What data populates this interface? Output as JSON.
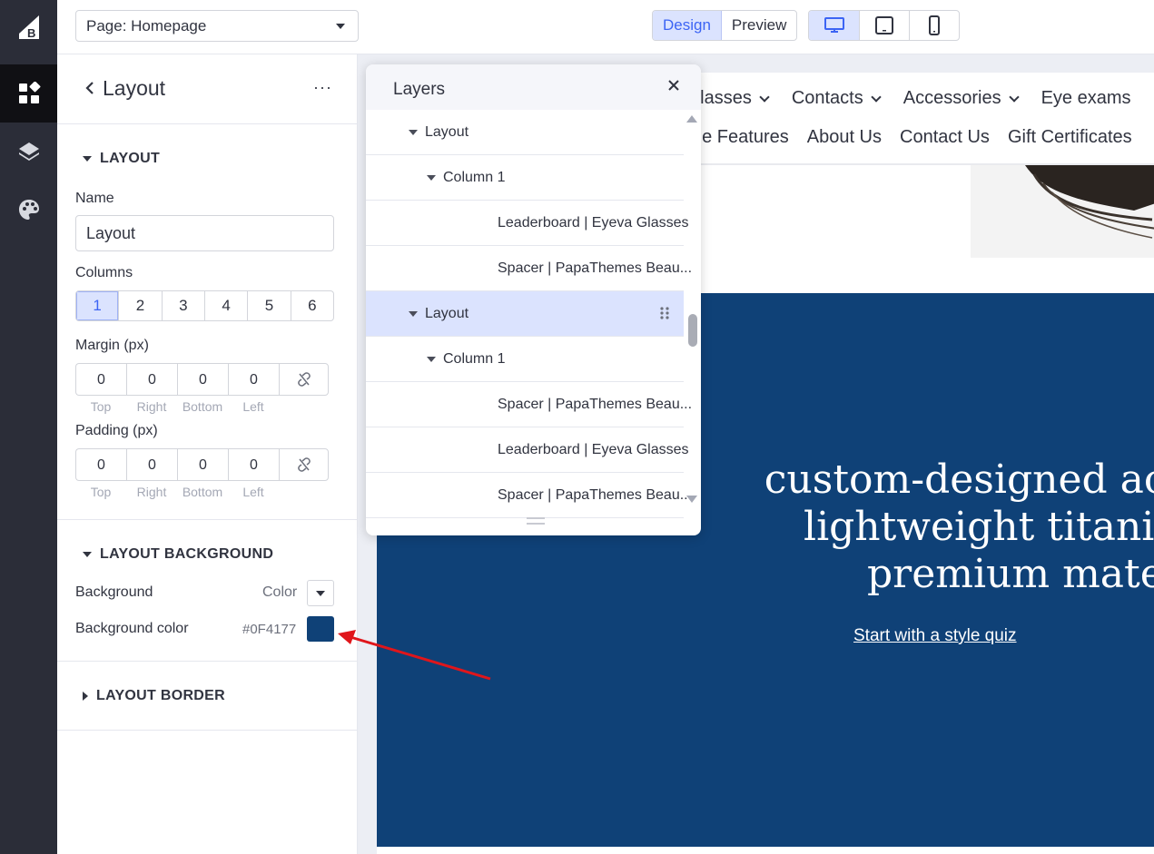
{
  "colors": {
    "accent": "#3c64f4",
    "brand_blue": "#0F4177",
    "rail": "#2b2d38",
    "arrow": "#e0161b"
  },
  "rail": {
    "icons": [
      "bigcommerce-logo",
      "widgets-icon",
      "layers-icon",
      "palette-icon"
    ]
  },
  "topbar": {
    "page_select": "Page: Homepage",
    "modes": [
      "Design",
      "Preview"
    ],
    "active_mode": "Design",
    "devices": [
      "desktop-icon",
      "tablet-icon",
      "mobile-icon"
    ],
    "active_device": "desktop"
  },
  "panel": {
    "title": "Layout",
    "more": "···",
    "layout_section": "LAYOUT",
    "name_label": "Name",
    "name_value": "Layout",
    "columns_label": "Columns",
    "columns": [
      "1",
      "2",
      "3",
      "4",
      "5",
      "6"
    ],
    "active_column": "1",
    "margin_label": "Margin (px)",
    "margin_values": [
      "0",
      "0",
      "0",
      "0"
    ],
    "padding_label": "Padding (px)",
    "padding_values": [
      "0",
      "0",
      "0",
      "0"
    ],
    "side_labels": [
      "Top",
      "Right",
      "Bottom",
      "Left"
    ],
    "bg_section": "LAYOUT BACKGROUND",
    "background_label": "Background",
    "background_value": "Color",
    "bg_color_label": "Background color",
    "bg_color_value": "#0F4177",
    "border_section": "LAYOUT BORDER"
  },
  "layers": {
    "title": "Layers",
    "items": [
      {
        "label": "Layout",
        "level": 0,
        "expandable": true,
        "selected": false
      },
      {
        "label": "Column 1",
        "level": 1,
        "expandable": true,
        "selected": false
      },
      {
        "label": "Leaderboard | Eyeva Glasses",
        "level": 2,
        "expandable": false,
        "selected": false
      },
      {
        "label": "Spacer | PapaThemes Beau...",
        "level": 2,
        "expandable": false,
        "selected": false
      },
      {
        "label": "Layout",
        "level": 0,
        "expandable": true,
        "selected": true
      },
      {
        "label": "Column 1",
        "level": 1,
        "expandable": true,
        "selected": false
      },
      {
        "label": "Spacer | PapaThemes Beau...",
        "level": 2,
        "expandable": false,
        "selected": false
      },
      {
        "label": "Leaderboard | Eyeva Glasses",
        "level": 2,
        "expandable": false,
        "selected": false
      },
      {
        "label": "Spacer | PapaThemes Beau...",
        "level": 2,
        "expandable": false,
        "selected": false
      }
    ]
  },
  "site": {
    "nav_primary": [
      "glasses",
      "Contacts",
      "Accessories",
      "Eye exams"
    ],
    "nav_secondary": [
      "ne Features",
      "About Us",
      "Contact Us",
      "Gift Certificates"
    ],
    "headline_lines": [
      "custom-designed acetate",
      "lightweight titanium, we use not",
      "premium materials in our fr"
    ],
    "cta": "Start with a style quiz"
  }
}
